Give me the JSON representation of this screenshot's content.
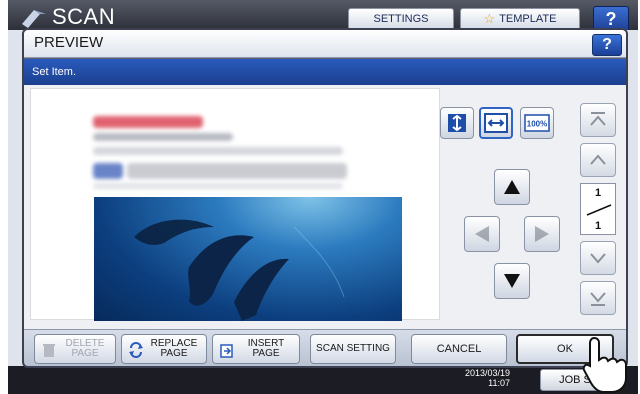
{
  "screen": {
    "title": "SCAN",
    "settings_label": "SETTINGS",
    "template_label": "TEMPLATE",
    "help_label": "?",
    "date_line": "2013/03/19",
    "time_line": "11:07",
    "job_label": "JOB S"
  },
  "dialog": {
    "title": "PREVIEW",
    "help_label": "?",
    "message": "Set Item.",
    "zoom_label": "100%",
    "page_indicator": {
      "current": "1",
      "total": "1"
    }
  },
  "footer": {
    "delete_label_1": "DELETE",
    "delete_label_2": "PAGE",
    "replace_label_1": "REPLACE",
    "replace_label_2": "PAGE",
    "insert_label_1": "INSERT",
    "insert_label_2": "PAGE",
    "scan_setting_label": "SCAN SETTING",
    "cancel_label": "CANCEL",
    "ok_label": "OK"
  },
  "colors": {
    "accent": "#2a5bbd",
    "header_bg": "#3a3d48"
  }
}
